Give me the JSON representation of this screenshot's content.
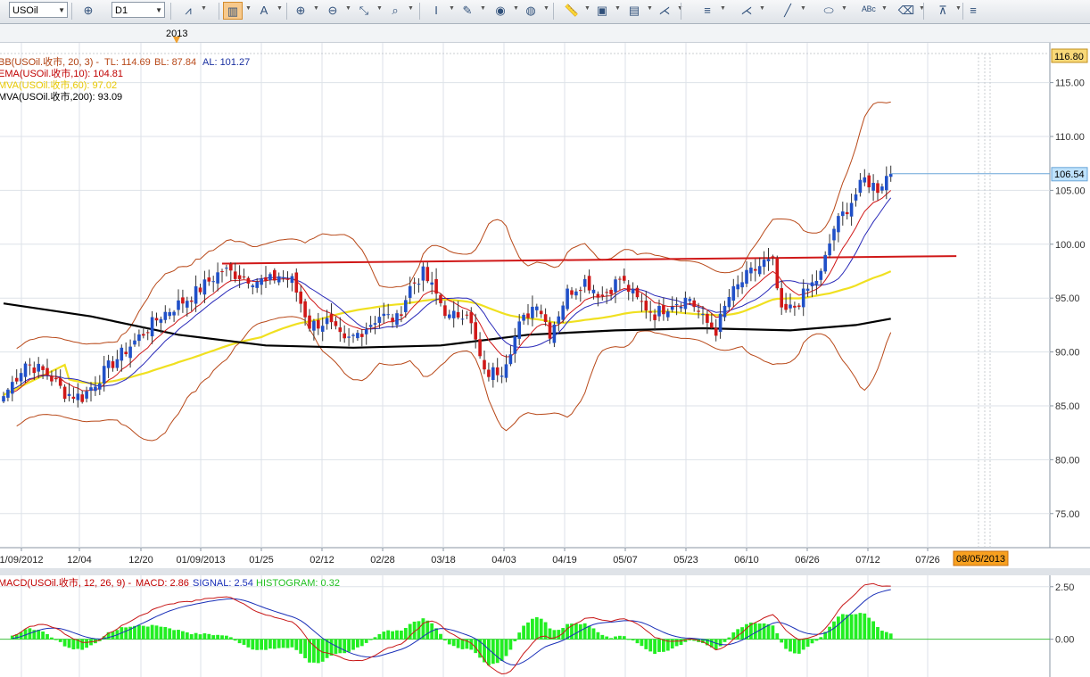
{
  "toolbar": {
    "symbol": "USOil",
    "timeframe": "D1",
    "buttons": [
      {
        "name": "crosshair-icon",
        "glyph": "⊕"
      },
      {
        "name": "chart-type-icon",
        "glyph": "⩘"
      },
      {
        "name": "candle-icon",
        "glyph": "▥",
        "active": true
      },
      {
        "name": "text-box-icon",
        "glyph": "A"
      },
      {
        "name": "zoom-in-icon",
        "glyph": "⊕"
      },
      {
        "name": "zoom-out-icon",
        "glyph": "⊖"
      },
      {
        "name": "fit-icon",
        "glyph": "⤡"
      },
      {
        "name": "zoom-box-icon",
        "glyph": "⌕"
      },
      {
        "name": "cursor-icon",
        "glyph": "I"
      },
      {
        "name": "chart-edit-icon",
        "glyph": "✎"
      },
      {
        "name": "eye-icon",
        "glyph": "◉"
      },
      {
        "name": "globe-icon",
        "glyph": "◍"
      },
      {
        "name": "ruler-icon",
        "glyph": "📏"
      },
      {
        "name": "image-icon",
        "glyph": "▣"
      },
      {
        "name": "screenshot-icon",
        "glyph": "▤"
      },
      {
        "name": "draw-lines-icon",
        "glyph": "⋌"
      },
      {
        "name": "menu-lines-icon",
        "glyph": "≡"
      },
      {
        "name": "fan-icon",
        "glyph": "⋌"
      },
      {
        "name": "pencil-icon",
        "glyph": "╱"
      },
      {
        "name": "ellipse-icon",
        "glyph": "⬭"
      },
      {
        "name": "abc-icon",
        "glyph": "ᴬᴮᶜ"
      },
      {
        "name": "eraser-icon",
        "glyph": "⌫"
      },
      {
        "name": "tree-icon",
        "glyph": "⊼"
      }
    ]
  },
  "year_label": "2013",
  "price_panel": {
    "legend": [
      {
        "text": "BB(USOil.收市, 20, 3) -",
        "color": "#b04010"
      },
      {
        "text": "EMA(USOil.收市,10): 104.81",
        "color": "#c00000"
      },
      {
        "text": "MVA(USOil.收市,60): 97.02",
        "color": "#e8c800"
      },
      {
        "text": "MVA(USOil.收市,200): 93.09",
        "color": "#000000"
      }
    ],
    "bb_values": {
      "tl": "TL: 114.69",
      "bl": "BL: 87.84",
      "al": "AL: 101.27"
    },
    "ymin": 72,
    "ymax": 117.7,
    "y_ticks": [
      75,
      80,
      85,
      90,
      95,
      100,
      105,
      110,
      115
    ],
    "y_tick_labels": [
      "75.00",
      "80.00",
      "85.00",
      "90.00",
      "95.00",
      "100.00",
      "105.00",
      "110.00",
      "115.00"
    ],
    "top_price_label": "116.80",
    "last_price_label": "106.54",
    "last_price": 106.54,
    "x_labels": [
      "1/09/2012",
      "12/04",
      "12/20",
      "01/09/2013",
      "01/25",
      "02/12",
      "02/28",
      "03/18",
      "04/03",
      "04/19",
      "05/07",
      "05/23",
      "06/10",
      "06/26",
      "07/12",
      "07/26"
    ],
    "future_date_label": "08/05/2013"
  },
  "macd_panel": {
    "legend_prefix": "MACD(USOil.收市, 12, 26, 9) -",
    "macd_text": "MACD: 2.86",
    "signal_text": "SIGNAL: 2.54",
    "hist_text": "HISTOGRAM: 0.32",
    "ymin": -1.8,
    "ymax": 3.0,
    "y_ticks": [
      0,
      2.5
    ],
    "y_tick_labels": [
      "0.00",
      "2.50"
    ]
  },
  "colors": {
    "bull": "#2050c8",
    "bear": "#d01818",
    "bb": "#b84818",
    "ema": "#d01818",
    "sma10": "#2828b8",
    "mva60": "#f0e020",
    "mva200": "#000000",
    "resistance": "#d01818",
    "hist": "#22ee22",
    "grid": "#dde2e8"
  },
  "chart_data": [
    {
      "type": "candlestick",
      "title": "USOil D1",
      "x_labels": [
        "1/09/2012",
        "12/04",
        "12/20",
        "01/09/2013",
        "01/25",
        "02/12",
        "02/28",
        "03/18",
        "04/03",
        "04/19",
        "05/07",
        "05/23",
        "06/10",
        "06/26",
        "07/12",
        "07/26"
      ],
      "ylim": [
        72,
        117.7
      ],
      "y_ticks": [
        75,
        80,
        85,
        90,
        95,
        100,
        105,
        110,
        115
      ],
      "close_anchors": [
        {
          "i": 0,
          "v": 85.9
        },
        {
          "i": 5,
          "v": 89.0
        },
        {
          "i": 10,
          "v": 88.0
        },
        {
          "i": 14,
          "v": 86.2
        },
        {
          "i": 18,
          "v": 85.8
        },
        {
          "i": 24,
          "v": 88.6
        },
        {
          "i": 30,
          "v": 91.0
        },
        {
          "i": 36,
          "v": 93.4
        },
        {
          "i": 43,
          "v": 95.2
        },
        {
          "i": 50,
          "v": 97.6
        },
        {
          "i": 55,
          "v": 97.0
        },
        {
          "i": 60,
          "v": 96.4
        },
        {
          "i": 63,
          "v": 97.1
        },
        {
          "i": 66,
          "v": 96.6
        },
        {
          "i": 70,
          "v": 92.5
        },
        {
          "i": 74,
          "v": 92.8
        },
        {
          "i": 78,
          "v": 90.8
        },
        {
          "i": 82,
          "v": 92.0
        },
        {
          "i": 86,
          "v": 93.4
        },
        {
          "i": 90,
          "v": 93.0
        },
        {
          "i": 93,
          "v": 96.0
        },
        {
          "i": 96,
          "v": 97.3
        },
        {
          "i": 99,
          "v": 95.3
        },
        {
          "i": 102,
          "v": 93.1
        },
        {
          "i": 106,
          "v": 93.9
        },
        {
          "i": 110,
          "v": 87.9
        },
        {
          "i": 114,
          "v": 88.4
        },
        {
          "i": 118,
          "v": 92.4
        },
        {
          "i": 122,
          "v": 94.8
        },
        {
          "i": 125,
          "v": 91.8
        },
        {
          "i": 129,
          "v": 95.5
        },
        {
          "i": 133,
          "v": 96.6
        },
        {
          "i": 137,
          "v": 95.2
        },
        {
          "i": 141,
          "v": 96.8
        },
        {
          "i": 145,
          "v": 94.8
        },
        {
          "i": 149,
          "v": 93.5
        },
        {
          "i": 153,
          "v": 94.6
        },
        {
          "i": 157,
          "v": 95.0
        },
        {
          "i": 160,
          "v": 93.0
        },
        {
          "i": 163,
          "v": 92.0
        },
        {
          "i": 166,
          "v": 95.1
        },
        {
          "i": 170,
          "v": 97.0
        },
        {
          "i": 174,
          "v": 98.3
        },
        {
          "i": 176,
          "v": 98.2
        },
        {
          "i": 178,
          "v": 93.5
        },
        {
          "i": 181,
          "v": 94.2
        },
        {
          "i": 184,
          "v": 95.8
        },
        {
          "i": 187,
          "v": 97.2
        },
        {
          "i": 190,
          "v": 101.5
        },
        {
          "i": 194,
          "v": 104.0
        },
        {
          "i": 197,
          "v": 106.0
        },
        {
          "i": 200,
          "v": 105.2
        },
        {
          "i": 202,
          "v": 106.3
        },
        {
          "i": 203,
          "v": 106.54
        }
      ],
      "indicators": {
        "bb": {
          "period": 20,
          "dev": 3,
          "tl": 114.69,
          "bl": 87.84,
          "al": 101.27
        },
        "ema": {
          "period": 10,
          "last": 104.81
        },
        "mva60": {
          "last": 97.02
        },
        "mva200": {
          "last": 93.09,
          "points": [
            [
              0,
              94.5
            ],
            [
              20,
              93.3
            ],
            [
              40,
              91.6
            ],
            [
              60,
              90.6
            ],
            [
              80,
              90.4
            ],
            [
              100,
              90.6
            ],
            [
              120,
              91.6
            ],
            [
              140,
              92.0
            ],
            [
              160,
              92.2
            ],
            [
              180,
              92.0
            ],
            [
              195,
              92.5
            ],
            [
              203,
              93.09
            ]
          ]
        }
      },
      "resistance_line": {
        "from": {
          "i": 50,
          "v": 98.2
        },
        "to": {
          "i": 218,
          "v": 98.9
        }
      }
    },
    {
      "type": "line",
      "title": "MACD(USOil.收市, 12, 26, 9)",
      "series": [
        {
          "name": "MACD",
          "last": 2.86
        },
        {
          "name": "SIGNAL",
          "last": 2.54
        },
        {
          "name": "HISTOGRAM",
          "last": 0.32
        }
      ],
      "ylim": [
        -1.8,
        3.0
      ],
      "y_ticks": [
        0,
        2.5
      ]
    }
  ]
}
